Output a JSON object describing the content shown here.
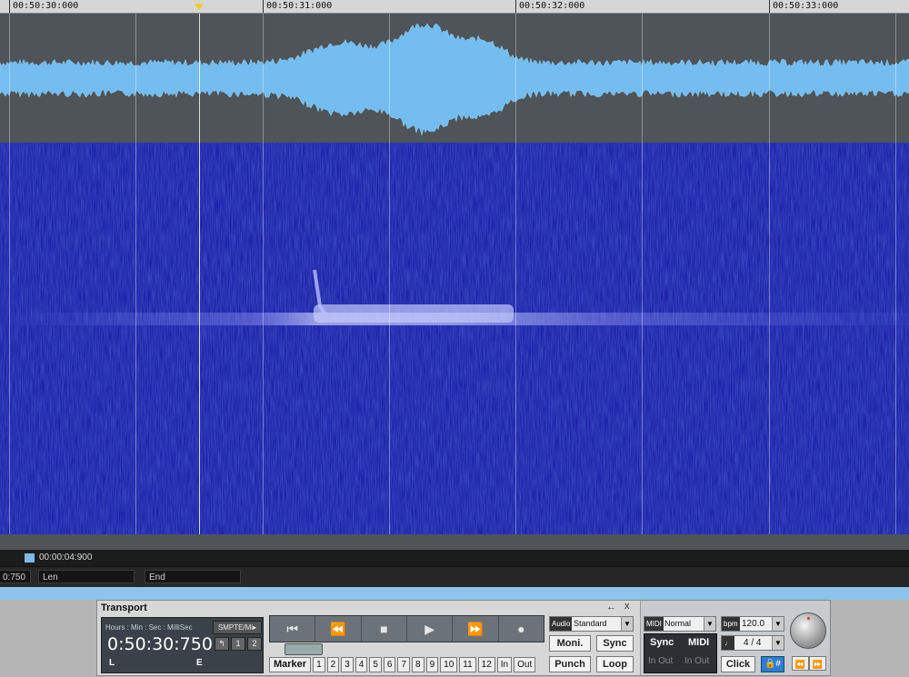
{
  "ruler": {
    "ticks": [
      "00:50:30:000",
      "00:50:31:000",
      "00:50:32:000",
      "00:50:33:000"
    ]
  },
  "selection": {
    "length": "00:00:04:900"
  },
  "fields": {
    "start_partial": "0:750",
    "len_label": "Len",
    "end_label": "End"
  },
  "transport": {
    "title": "Transport",
    "pin_glyph": "←",
    "close_glyph": "x",
    "time_format_label": "Hours : Min : Sec : MilliSec",
    "smpte_button": "SMPTE/Mi▸",
    "time": "0:50:30:750",
    "mini_buttons": [
      "↰",
      "1",
      "2"
    ],
    "left_label": "L",
    "end_label": "E",
    "buttons": [
      "⏮",
      "⏪",
      "■",
      "▶",
      "⏩",
      "●"
    ],
    "marker_label": "Marker",
    "marker_numbers": [
      "1",
      "2",
      "3",
      "4",
      "5",
      "6",
      "7",
      "8",
      "9",
      "10",
      "11",
      "12"
    ],
    "in_label": "In",
    "out_label": "Out",
    "audio_tag": "Audio",
    "audio_mode": "Standard",
    "monitor_button": "Moni.",
    "sync_button": "Sync",
    "punch_button": "Punch",
    "loop_button": "Loop",
    "midi_tag": "MIDI",
    "midi_mode": "Normal",
    "sync_label": "Sync",
    "midi_label": "MIDI",
    "in_out_1": "In Out",
    "in_out_2": "In Out",
    "bpm_tag": "bpm",
    "bpm_value": "120.0",
    "meter_tag": "♩",
    "meter_value": "4 / 4",
    "click_button": "Click",
    "lock_button": "🔒#",
    "rewind_glyph": "⏪",
    "forward_glyph": "⏩"
  },
  "colors": {
    "waveform": "#74bdf0",
    "spectrogram_base": "#1a1fa6",
    "accent_blue": "#2f7bd6"
  }
}
